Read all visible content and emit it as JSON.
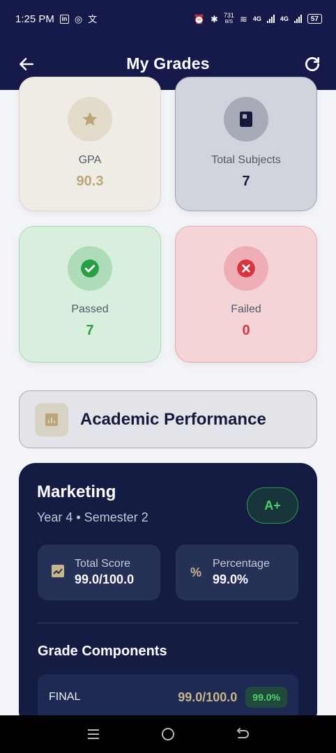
{
  "status_bar": {
    "time": "1:25 PM",
    "net_speed_top": "731",
    "net_speed_unit": "B/S",
    "network_1": "4G",
    "network_2": "4G",
    "battery": "57"
  },
  "app_bar": {
    "title": "My Grades",
    "back_icon": "arrow-left-icon",
    "refresh_icon": "refresh-icon"
  },
  "stats": {
    "gpa": {
      "label": "GPA",
      "value": "90.3",
      "icon": "star-icon",
      "color": "#bca677"
    },
    "total_subjects": {
      "label": "Total Subjects",
      "value": "7",
      "icon": "book-icon",
      "color": "#151a3a"
    },
    "passed": {
      "label": "Passed",
      "value": "7",
      "icon": "check-circle-icon",
      "color": "#2a9d47"
    },
    "failed": {
      "label": "Failed",
      "value": "0",
      "icon": "x-circle-icon",
      "color": "#d6343f"
    }
  },
  "section": {
    "title": "Academic Performance",
    "icon": "chart-icon"
  },
  "subject": {
    "name": "Marketing",
    "meta": "Year 4 • Semester 2",
    "grade": "A+",
    "total_score_label": "Total Score",
    "total_score_value": "99.0/100.0",
    "percentage_label": "Percentage",
    "percentage_value": "99.0%",
    "components_title": "Grade Components",
    "components": [
      {
        "name": "FINAL",
        "score": "99.0/100.0",
        "percentage": "99.0%"
      }
    ]
  },
  "nav": {
    "recents_icon": "menu-icon",
    "home_icon": "home-circle-icon",
    "back_icon": "back-arrow-icon"
  }
}
